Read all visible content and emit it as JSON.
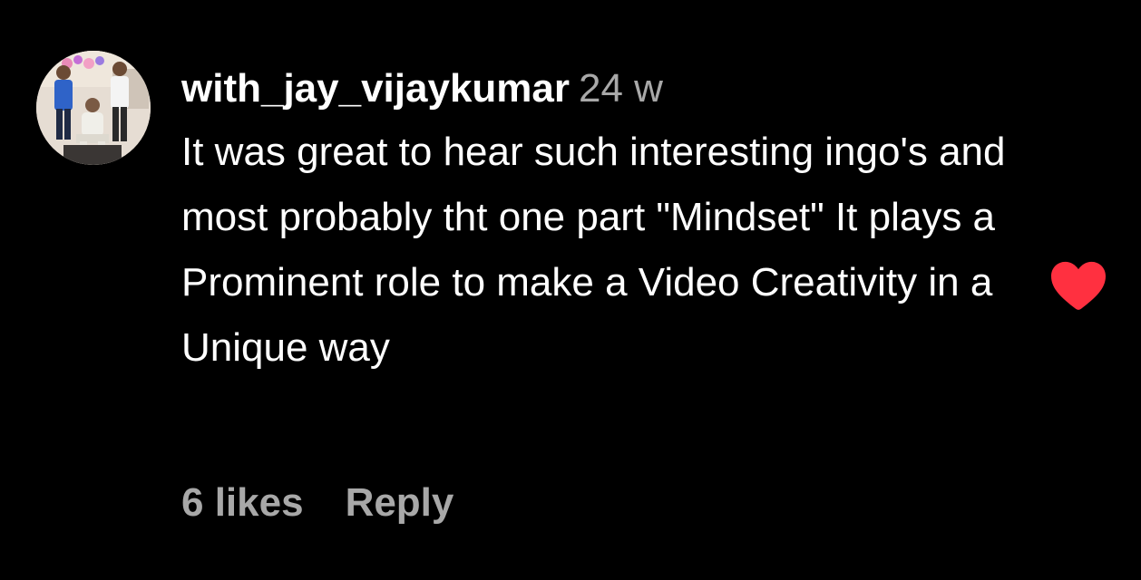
{
  "comment": {
    "username": "with_jay_vijaykumar",
    "timestamp": "24 w",
    "text": "It was great to hear such interesting ingo's and most probably tht one part \"Mindset\" It plays a Prominent role to make a Video Creativity in a Unique way",
    "likes_label": "6 likes",
    "reply_label": "Reply",
    "liked": true
  },
  "icons": {
    "avatar": "user-photo-avatar",
    "like": "heart-icon"
  },
  "colors": {
    "background": "#000000",
    "text": "#ffffff",
    "secondary_text": "#a8a8a8",
    "heart": "#ff3040"
  }
}
